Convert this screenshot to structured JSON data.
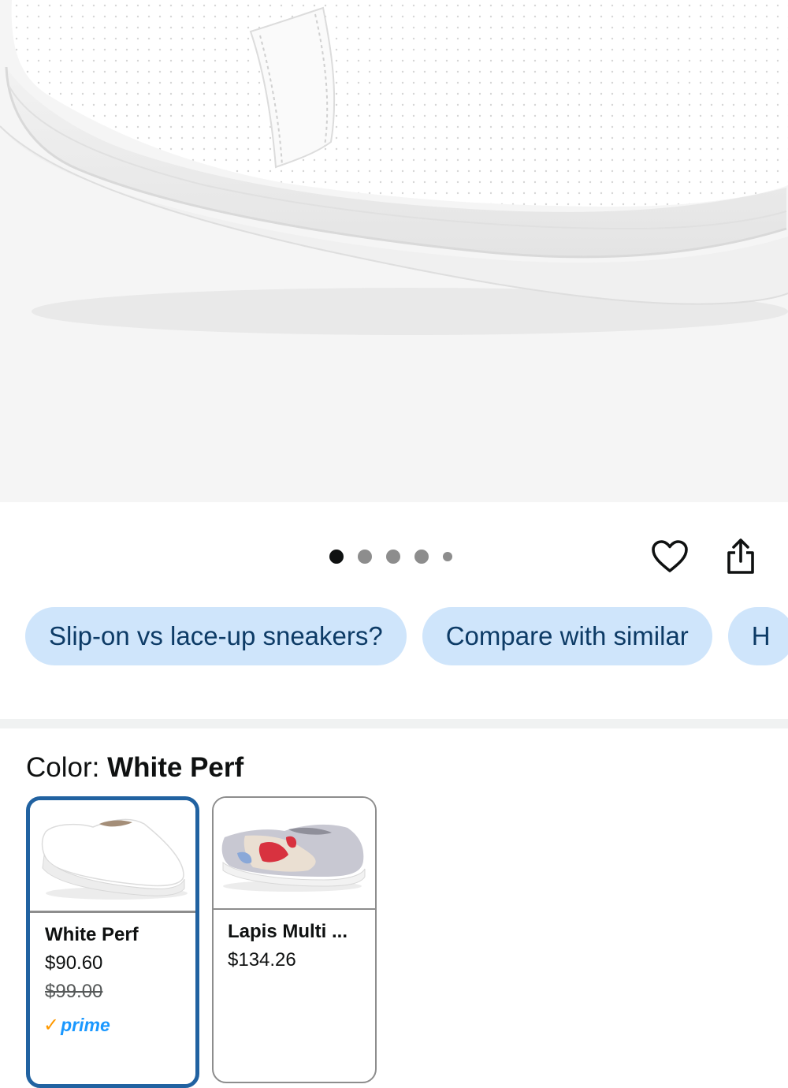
{
  "gallery": {
    "image_alt": "White perforated slip-on sneaker",
    "dot_count": 5,
    "active_index": 0
  },
  "actions": {
    "favorite_icon": "heart-outline-icon",
    "share_icon": "share-icon"
  },
  "chips": [
    "Slip-on vs lace-up sneakers?",
    "Compare with similar",
    "H"
  ],
  "color": {
    "label": "Color: ",
    "selected": "White Perf",
    "options": [
      {
        "name": "White Perf",
        "price": "$90.60",
        "list_price": "$99.00",
        "prime_label": "prime",
        "selected": true
      },
      {
        "name": "Lapis Multi ...",
        "price": "$134.26",
        "selected": false
      }
    ]
  },
  "colors": {
    "chip_bg": "#cfe5fb",
    "chip_text": "#0d3b66",
    "selected_border": "#2162a1",
    "prime_blue": "#1a98ff",
    "prime_check": "#ff9900"
  }
}
